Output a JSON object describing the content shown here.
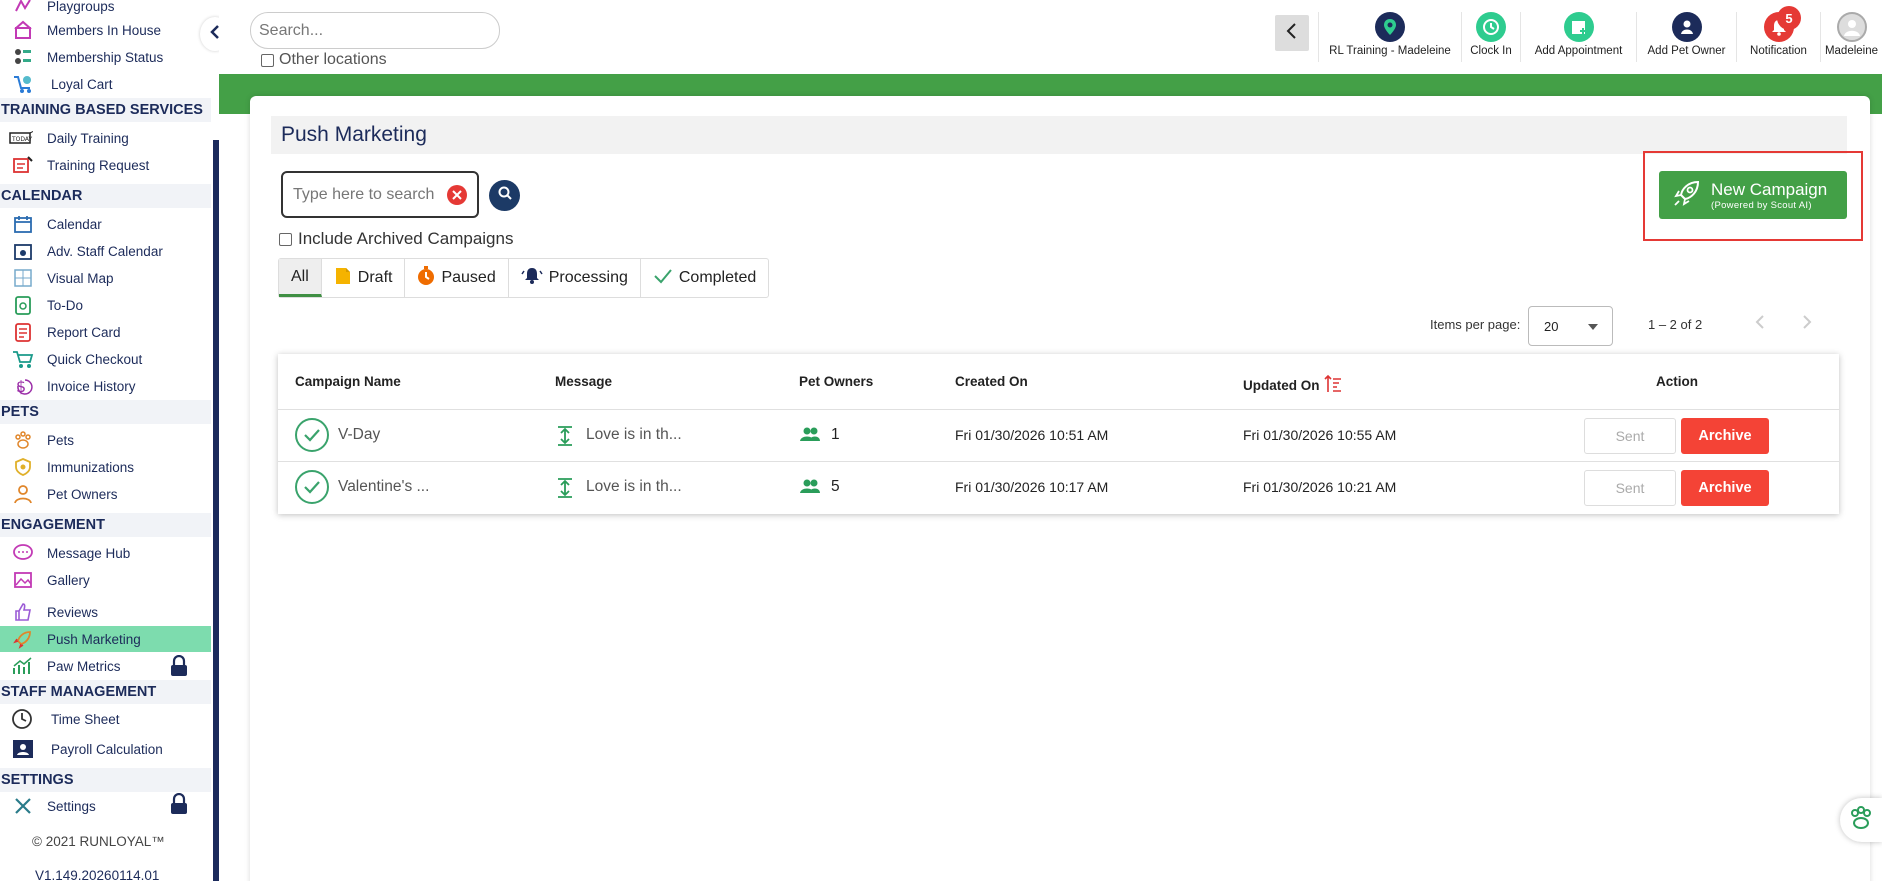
{
  "sidebar": {
    "items": [
      {
        "label": "Playgroups",
        "icon": "playgroups-icon"
      },
      {
        "label": "Members In House",
        "icon": "house-icon"
      },
      {
        "label": "Membership Status",
        "icon": "membership-icon"
      },
      {
        "label": "Loyal Cart",
        "icon": "cart-icon"
      },
      {
        "label": "Daily Training",
        "icon": "training-icon"
      },
      {
        "label": "Training Request",
        "icon": "request-icon"
      },
      {
        "label": "Calendar",
        "icon": "calendar-icon"
      },
      {
        "label": "Adv. Staff Calendar",
        "icon": "staff-calendar-icon"
      },
      {
        "label": "Visual Map",
        "icon": "map-icon"
      },
      {
        "label": "To-Do",
        "icon": "todo-icon"
      },
      {
        "label": "Report Card",
        "icon": "report-icon"
      },
      {
        "label": "Quick Checkout",
        "icon": "checkout-icon"
      },
      {
        "label": "Invoice History",
        "icon": "invoice-icon"
      },
      {
        "label": "Pets",
        "icon": "paw-icon"
      },
      {
        "label": "Immunizations",
        "icon": "shield-icon"
      },
      {
        "label": "Pet Owners",
        "icon": "person-icon"
      },
      {
        "label": "Message Hub",
        "icon": "chat-icon"
      },
      {
        "label": "Gallery",
        "icon": "gallery-icon"
      },
      {
        "label": "Reviews",
        "icon": "thumbs-up-icon"
      },
      {
        "label": "Push Marketing",
        "icon": "rocket-icon"
      },
      {
        "label": "Paw Metrics",
        "icon": "metrics-icon"
      },
      {
        "label": "Time Sheet",
        "icon": "clock-icon"
      },
      {
        "label": "Payroll Calculation",
        "icon": "payroll-icon"
      },
      {
        "label": "Settings",
        "icon": "tools-icon"
      }
    ],
    "sections": {
      "training": "TRAINING BASED SERVICES",
      "calendar": "CALENDAR",
      "pets": "PETS",
      "engagement": "ENGAGEMENT",
      "staff": "STAFF MANAGEMENT",
      "settings": "SETTINGS"
    },
    "footer": "© 2021  RUNLOYAL™",
    "version": "V1.149.20260114.01",
    "active_color": "#7ddcae"
  },
  "topbar": {
    "search_placeholder": "Search...",
    "other_locations": "Other locations",
    "actions": [
      {
        "label": "RL Training - Madeleine",
        "icon": "location-pin-icon",
        "color": "#1c2b5a"
      },
      {
        "label": "Clock In",
        "icon": "clock-icon",
        "color": "#2ecc8f"
      },
      {
        "label": "Add Appointment",
        "icon": "calendar-plus-icon",
        "color": "#2ecc8f"
      },
      {
        "label": "Add Pet Owner",
        "icon": "add-person-icon",
        "color": "#1c2b5a"
      },
      {
        "label": "Notification",
        "icon": "bell-icon",
        "color": "#e53935"
      },
      {
        "label": "Madeleine",
        "icon": "avatar-icon",
        "color": "#ccc"
      }
    ],
    "notification_count": "5"
  },
  "page": {
    "title": "Push Marketing",
    "search_placeholder": "Type here to search",
    "include_archived": "Include Archived Campaigns",
    "tabs": [
      "All",
      "Draft",
      "Paused",
      "Processing",
      "Completed"
    ],
    "new_campaign": "New Campaign",
    "new_campaign_sub": "(Powered by Scout AI)",
    "items_per_page_label": "Items per page:",
    "items_per_page": "20",
    "range": "1 – 2 of 2",
    "brand_color": "#44a047"
  },
  "table": {
    "headers": [
      "Campaign Name",
      "Message",
      "Pet Owners",
      "Created On",
      "Updated On",
      "Action"
    ],
    "rows": [
      {
        "name": "V-Day",
        "message": "Love is in th...",
        "owners": "1",
        "created": "Fri 01/30/2026 10:51 AM",
        "updated": "Fri 01/30/2026 10:55 AM",
        "sent": "Sent",
        "archive": "Archive"
      },
      {
        "name": "Valentine's ...",
        "message": "Love is in th...",
        "owners": "5",
        "created": "Fri 01/30/2026 10:17 AM",
        "updated": "Fri 01/30/2026 10:21 AM",
        "sent": "Sent",
        "archive": "Archive"
      }
    ]
  }
}
